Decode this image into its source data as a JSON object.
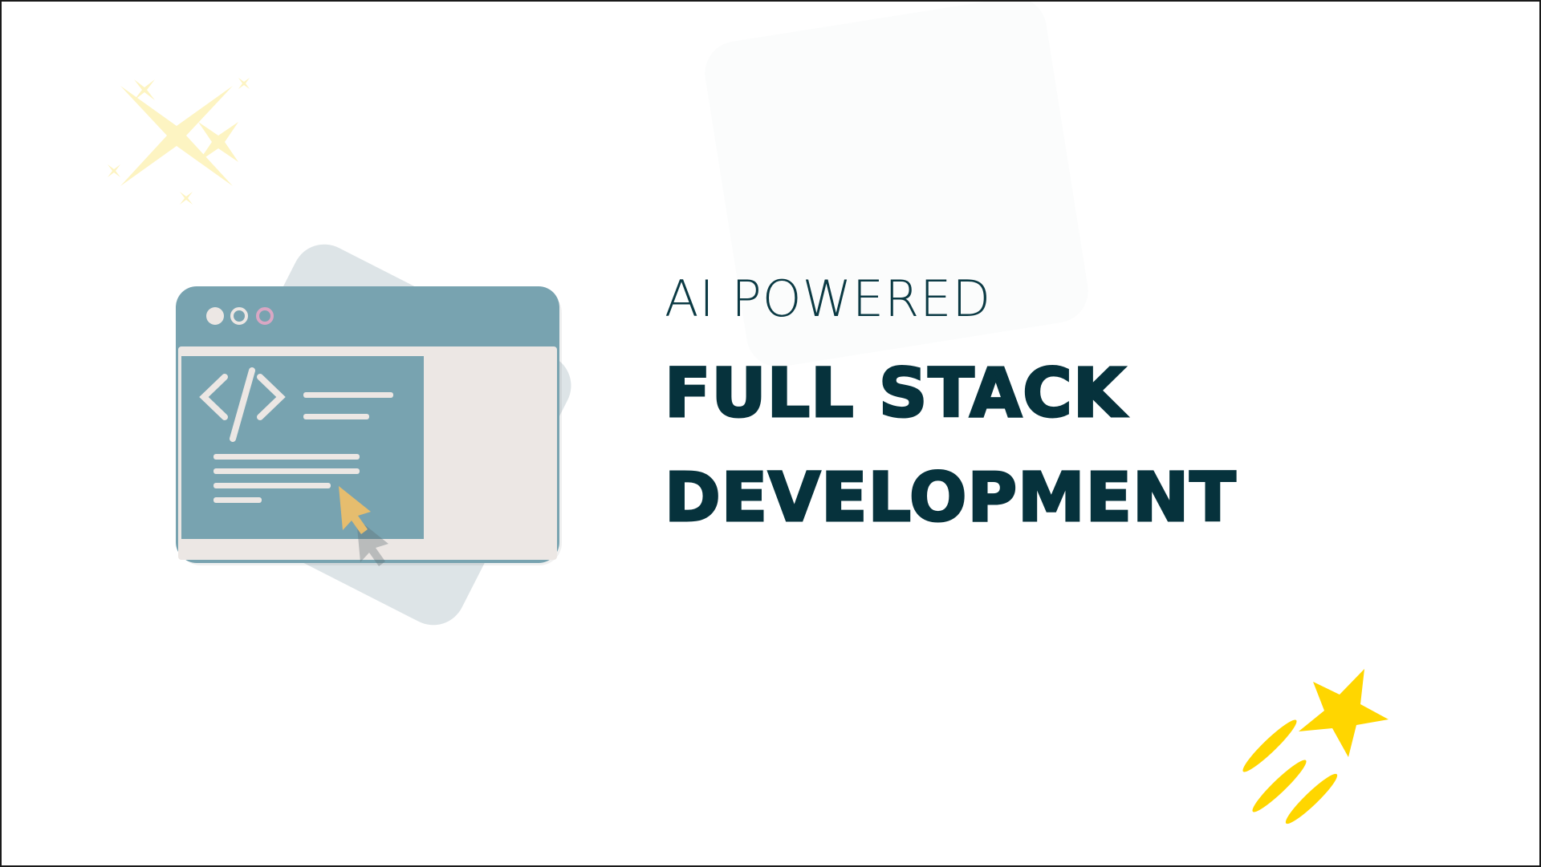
{
  "headline": {
    "subtitle": "AI POWERED",
    "title_line_1": "FULL STACK",
    "title_line_2": "DEVELOPMENT"
  },
  "illustration": {
    "code_symbol": "</>",
    "icon": "browser-window-code-icon"
  },
  "colors": {
    "title": "#06323c",
    "browser_frame": "#78a3b0",
    "browser_body": "#ece7e4",
    "cursor": "#e6bd6e",
    "star": "#ffd600",
    "sparkle": "#fdf6c9",
    "backdrop": "#dde4e7"
  }
}
